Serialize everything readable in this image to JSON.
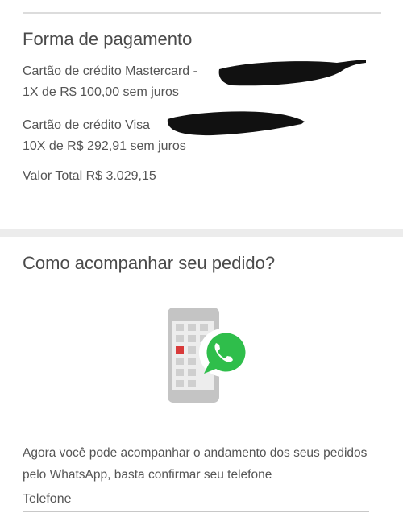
{
  "payment": {
    "title": "Forma de pagamento",
    "mastercard_line": "Cartão de crédito Mastercard - ",
    "mastercard_installments": "1X de R$ 100,00 sem juros",
    "visa_line": "Cartão de crédito Visa ",
    "visa_installments": "10X de R$ 292,91 sem juros",
    "total": "Valor Total R$ 3.029,15"
  },
  "tracking": {
    "title": "Como acompanhar seu pedido?",
    "illustration_icon": "phone-whatsapp-icon",
    "description": "Agora você pode acompanhar o andamento dos seus pedidos pelo WhatsApp, basta confirmar seu telefone",
    "phone_label": "Telefone"
  },
  "colors": {
    "whatsapp_green": "#2fbe4b",
    "highlight_red": "#d83a3a"
  }
}
